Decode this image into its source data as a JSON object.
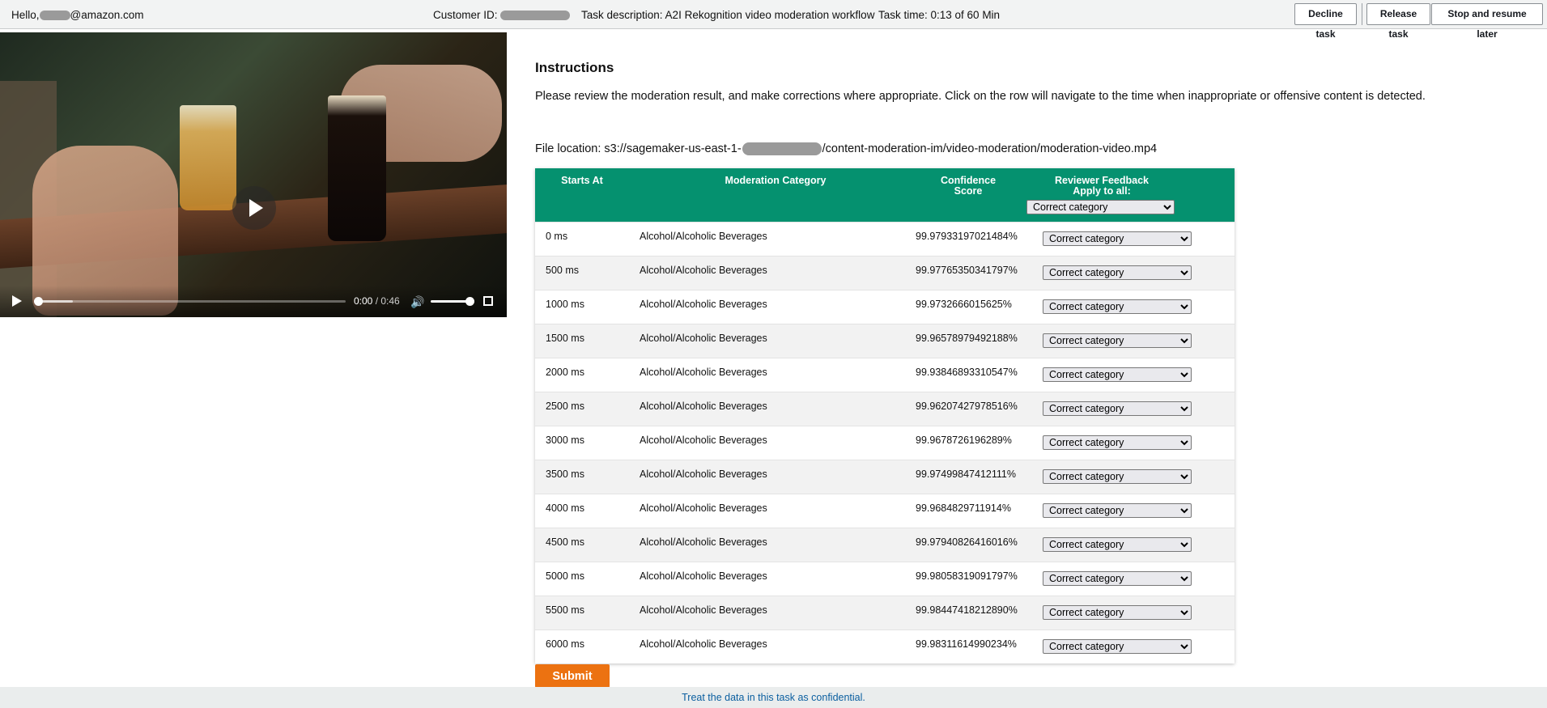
{
  "topbar": {
    "hello_prefix": "Hello,",
    "hello_suffix": "@amazon.com",
    "customer_id_label": "Customer ID:",
    "task_description": "Task description: A2I Rekognition video moderation workflow",
    "task_time": "Task time: 0:13 of 60 Min",
    "decline_label": "Decline task",
    "release_label": "Release task",
    "stop_label": "Stop and resume later"
  },
  "video": {
    "current_time": "0:00",
    "duration": "0:46",
    "progress": 0.0
  },
  "instructions": {
    "title": "Instructions",
    "text": "Please review the moderation result, and make corrections where appropriate. Click on the row will navigate to the time when inappropriate or offensive content is detected.",
    "file_prefix": "File location: s3://sagemaker-us-east-1-",
    "file_suffix": "/content-moderation-im/video-moderation/moderation-video.mp4"
  },
  "table": {
    "headers": {
      "starts_at": "Starts At",
      "category": "Moderation Category",
      "confidence_line1": "Confidence",
      "confidence_line2": "Score",
      "feedback_line1": "Reviewer Feedback",
      "feedback_line2": "Apply to all:"
    },
    "apply_all_value": "Correct category",
    "rows": [
      {
        "start": "0 ms",
        "category": "Alcohol/Alcoholic Beverages",
        "score": "99.97933197021484%",
        "feedback": "Correct category"
      },
      {
        "start": "500 ms",
        "category": "Alcohol/Alcoholic Beverages",
        "score": "99.97765350341797%",
        "feedback": "Correct category"
      },
      {
        "start": "1000 ms",
        "category": "Alcohol/Alcoholic Beverages",
        "score": "99.9732666015625%",
        "feedback": "Correct category"
      },
      {
        "start": "1500 ms",
        "category": "Alcohol/Alcoholic Beverages",
        "score": "99.96578979492188%",
        "feedback": "Correct category"
      },
      {
        "start": "2000 ms",
        "category": "Alcohol/Alcoholic Beverages",
        "score": "99.93846893310547%",
        "feedback": "Correct category"
      },
      {
        "start": "2500 ms",
        "category": "Alcohol/Alcoholic Beverages",
        "score": "99.96207427978516%",
        "feedback": "Correct category"
      },
      {
        "start": "3000 ms",
        "category": "Alcohol/Alcoholic Beverages",
        "score": "99.9678726196289%",
        "feedback": "Correct category"
      },
      {
        "start": "3500 ms",
        "category": "Alcohol/Alcoholic Beverages",
        "score": "99.97499847412111%",
        "feedback": "Correct category"
      },
      {
        "start": "4000 ms",
        "category": "Alcohol/Alcoholic Beverages",
        "score": "99.9684829711914%",
        "feedback": "Correct category"
      },
      {
        "start": "4500 ms",
        "category": "Alcohol/Alcoholic Beverages",
        "score": "99.97940826416016%",
        "feedback": "Correct category"
      },
      {
        "start": "5000 ms",
        "category": "Alcohol/Alcoholic Beverages",
        "score": "99.98058319091797%",
        "feedback": "Correct category"
      },
      {
        "start": "5500 ms",
        "category": "Alcohol/Alcoholic Beverages",
        "score": "99.98447418212890%",
        "feedback": "Correct category"
      },
      {
        "start": "6000 ms",
        "category": "Alcohol/Alcoholic Beverages",
        "score": "99.98311614990234%",
        "feedback": "Correct category"
      }
    ]
  },
  "submit_label": "Submit",
  "footer_text": "Treat the data in this task as confidential.",
  "colors": {
    "header_green": "#05916f",
    "submit_orange": "#ec7211",
    "footer_link": "#0b5fa0"
  }
}
